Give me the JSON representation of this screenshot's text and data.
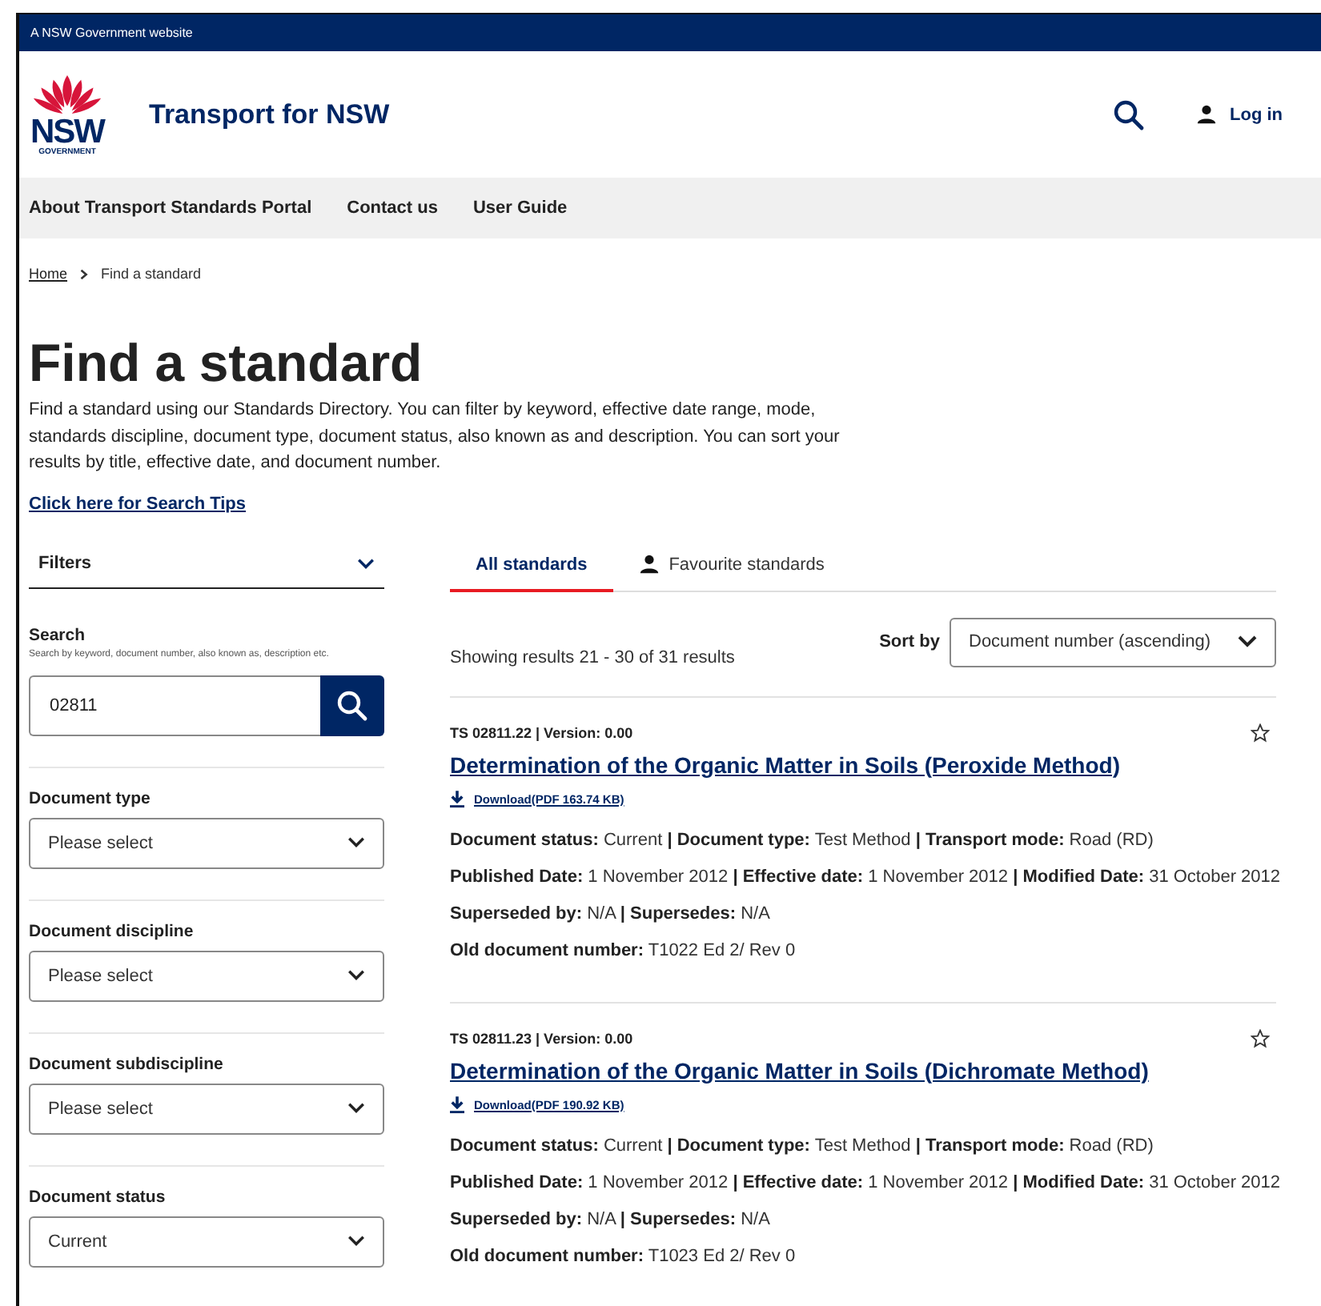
{
  "top_bar": {
    "text": "A NSW Government website"
  },
  "header": {
    "logo_word": "NSW",
    "logo_sub": "GOVERNMENT",
    "site_title": "Transport for NSW",
    "login": "Log in"
  },
  "nav": [
    "About Transport Standards Portal",
    "Contact us",
    "User Guide"
  ],
  "breadcrumb": [
    {
      "label": "Home",
      "kind": "link"
    },
    {
      "label": "Find a standard",
      "kind": "current"
    }
  ],
  "page": {
    "title": "Find a standard",
    "description": "Find a standard using our Standards Directory. You can filter by keyword, effective date range, mode, standards discipline, document type, document status, also known as and description. You can sort your results by title, effective date, and document number.",
    "tips_link": "Click here for Search Tips"
  },
  "filters": {
    "title": "Filters",
    "expanded": true,
    "search_label": "Search",
    "search_hint": "Search by keyword, document number, also known as, description etc.",
    "search_value": "02811",
    "selects": [
      {
        "label": "Document type",
        "value": "Please select"
      },
      {
        "label": "Document discipline",
        "value": "Please select"
      },
      {
        "label": "Document subdiscipline",
        "value": "Please select"
      },
      {
        "label": "Document status",
        "value": "Current"
      }
    ]
  },
  "tabs": [
    {
      "label": "All standards",
      "selected": true,
      "kind": "plain"
    },
    {
      "label": "Favourite standards",
      "selected": false,
      "kind": "person"
    }
  ],
  "results_summary": "Showing results 21 - 30 of 31 results",
  "sort": {
    "label": "Sort by",
    "value": "Document number (ascending)"
  },
  "results": [
    {
      "id_line": "TS 02811.22 | Version: 0.00",
      "title": "Determination of the Organic Matter in Soils (Peroxide Method)",
      "download": "Download(PDF 163.74 KB)",
      "favourite": false,
      "meta": [
        "**Document status:** Current **|** **Document type:** Test Method **|** **Transport mode:** Road (RD)",
        "**Published Date:** 1 November 2012 **|** **Effective date:** 1 November 2012 **|** **Modified Date:** 31 October 2012",
        "**Superseded by:** N/A **|** **Supersedes:** N/A",
        "**Old document number:** T1022 Ed 2/ Rev 0"
      ]
    },
    {
      "id_line": "TS 02811.23 | Version: 0.00",
      "title": "Determination of the Organic Matter in Soils (Dichromate Method)",
      "download": "Download(PDF 190.92 KB)",
      "favourite": false,
      "meta": [
        "**Document status:** Current **|** **Document type:** Test Method **|** **Transport mode:** Road (RD)",
        "**Published Date:** 1 November 2012 **|** **Effective date:** 1 November 2012 **|** **Modified Date:** 31 October 2012",
        "**Superseded by:** N/A **|** **Supersedes:** N/A",
        "**Old document number:** T1023 Ed 2/ Rev 0"
      ]
    }
  ]
}
